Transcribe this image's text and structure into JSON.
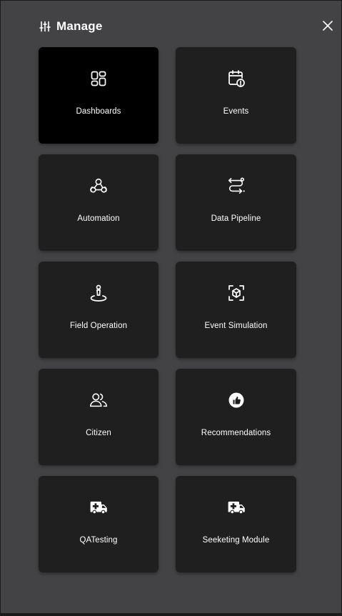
{
  "header": {
    "icon": "sliders-icon",
    "title": "Manage",
    "close_icon": "close-icon"
  },
  "tiles": [
    {
      "label": "Dashboards",
      "icon": "grid-layout-icon",
      "active": true
    },
    {
      "label": "Events",
      "icon": "calendar-alert-icon",
      "active": false
    },
    {
      "label": "Automation",
      "icon": "webhook-icon",
      "active": false
    },
    {
      "label": "Data Pipeline",
      "icon": "route-icon",
      "active": false
    },
    {
      "label": "Field Operation",
      "icon": "location-person-icon",
      "active": false
    },
    {
      "label": "Event Simulation",
      "icon": "cube-scan-icon",
      "active": false
    },
    {
      "label": "Citizen",
      "icon": "users-icon",
      "active": false
    },
    {
      "label": "Recommendations",
      "icon": "thumbs-up-circle-icon",
      "active": false
    },
    {
      "label": "QATesting",
      "icon": "ambulance-icon",
      "active": false
    },
    {
      "label": "Seeketing Module",
      "icon": "ambulance-icon",
      "active": false
    }
  ],
  "colors": {
    "panel_background": "#434244",
    "tile_background": "#1f1f1f",
    "active_tile_background": "#000000",
    "text": "#ffffff"
  }
}
